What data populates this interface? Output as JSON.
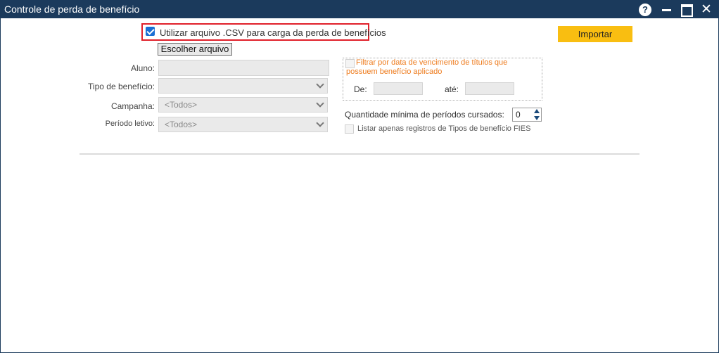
{
  "window": {
    "title": "Controle de perda de benefício",
    "help_glyph": "?",
    "close_glyph": "✕"
  },
  "csv": {
    "checked": true,
    "label": "Utilizar arquivo .CSV para carga da perda de benefícios",
    "choose_button": "Escolher arquivo"
  },
  "import_button": "Importar",
  "form": {
    "aluno_label": "Aluno:",
    "aluno_value": "",
    "tipo_label": "Tipo de benefício:",
    "tipo_value": "",
    "campanha_label": "Campanha:",
    "campanha_value": "<Todos>",
    "periodo_label": "Período letivo:",
    "periodo_value": "<Todos>"
  },
  "filter": {
    "checked": false,
    "label": "Filtrar por data de vencimento de títulos que possuem benefício aplicado",
    "de_label": "De:",
    "de_value": "",
    "ate_label": "até:",
    "ate_value": ""
  },
  "quantity": {
    "label": "Quantidade mínima de períodos cursados:",
    "value": "0"
  },
  "fies": {
    "checked": false,
    "label": "Listar apenas registros de Tipos de benefício FIES"
  },
  "colors": {
    "titlebar": "#1b3a5c",
    "accent_button": "#f9be11",
    "highlight": "#e0202a",
    "filter_label": "#ee7a1b",
    "checkbox_checked": "#1a6fd4"
  }
}
